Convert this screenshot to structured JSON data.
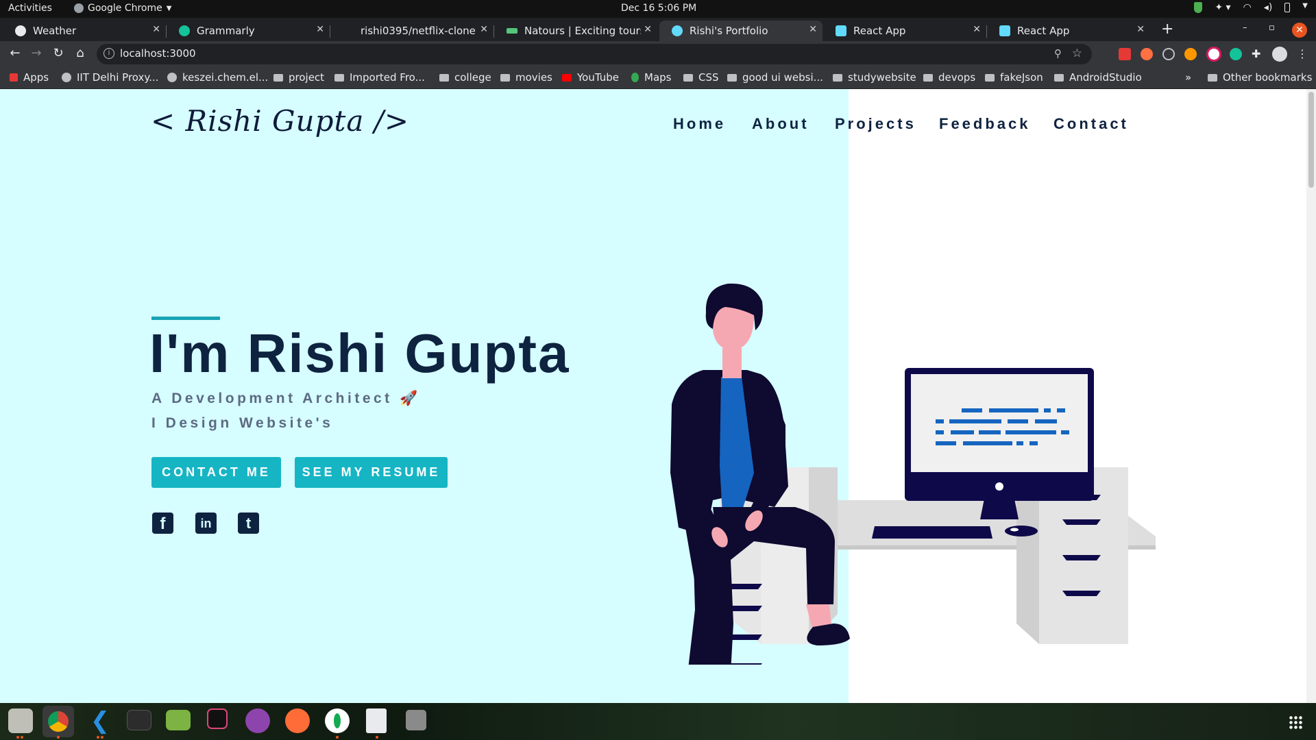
{
  "system_bar": {
    "activities": "Activities",
    "app_name": "Google Chrome",
    "clock": "Dec 16  5:06 PM"
  },
  "tabs": [
    {
      "title": "Weather",
      "favicon_color": "#e8eaed"
    },
    {
      "title": "Grammarly",
      "favicon_color": "#15c39a"
    },
    {
      "title": "rishi0395/netflix-clone",
      "favicon_color": "#202124"
    },
    {
      "title": "Natours | Exciting tours fo",
      "favicon_color": "#55c57a"
    },
    {
      "title": "Rishi's Portfolio",
      "favicon_color": "#61dafb",
      "active": true
    },
    {
      "title": "React App",
      "favicon_color": "#61dafb"
    },
    {
      "title": "React App",
      "favicon_color": "#61dafb"
    }
  ],
  "address_bar": {
    "url": "localhost:3000"
  },
  "bookmarks": [
    {
      "label": "Apps"
    },
    {
      "label": "IIT Delhi Proxy..."
    },
    {
      "label": "keszei.chem.el..."
    },
    {
      "label": "project"
    },
    {
      "label": "Imported Fro..."
    },
    {
      "label": "college"
    },
    {
      "label": "movies"
    },
    {
      "label": "YouTube"
    },
    {
      "label": "Maps"
    },
    {
      "label": "CSS"
    },
    {
      "label": "good ui websi..."
    },
    {
      "label": "studywebsite"
    },
    {
      "label": "devops"
    },
    {
      "label": "fakeJson"
    },
    {
      "label": "AndroidStudio"
    }
  ],
  "bookmarks_overflow": "»",
  "other_bookmarks": "Other bookmarks",
  "site": {
    "logo": "< Rishi Gupta />",
    "nav": [
      "Home",
      "About",
      "Projects",
      "Feedback",
      "Contact"
    ],
    "hero_title": "I'm Rishi Gupta",
    "hero_subtitle_1": "A Development Architect 🚀",
    "hero_subtitle_2": "I Design Website's",
    "button_contact": "CONTACT ME",
    "button_resume": "SEE MY RESUME",
    "social": [
      {
        "icon": "facebook-icon",
        "glyph": "f"
      },
      {
        "icon": "linkedin-icon",
        "glyph": "in"
      },
      {
        "icon": "twitter-icon",
        "glyph": "t"
      }
    ],
    "colors": {
      "hero_bg": "#d6fdff",
      "accent": "#16b5c4",
      "navy": "#0e2340",
      "subtitle": "#5c6a82"
    }
  },
  "dock": [
    {
      "name": "files-icon"
    },
    {
      "name": "chrome-icon"
    },
    {
      "name": "vscode-icon"
    },
    {
      "name": "terminal-icon"
    },
    {
      "name": "image-viewer-icon"
    },
    {
      "name": "intellij-icon"
    },
    {
      "name": "github-desktop-icon"
    },
    {
      "name": "postman-icon"
    },
    {
      "name": "mongodb-compass-icon"
    },
    {
      "name": "text-editor-icon"
    },
    {
      "name": "disk-icon"
    }
  ]
}
